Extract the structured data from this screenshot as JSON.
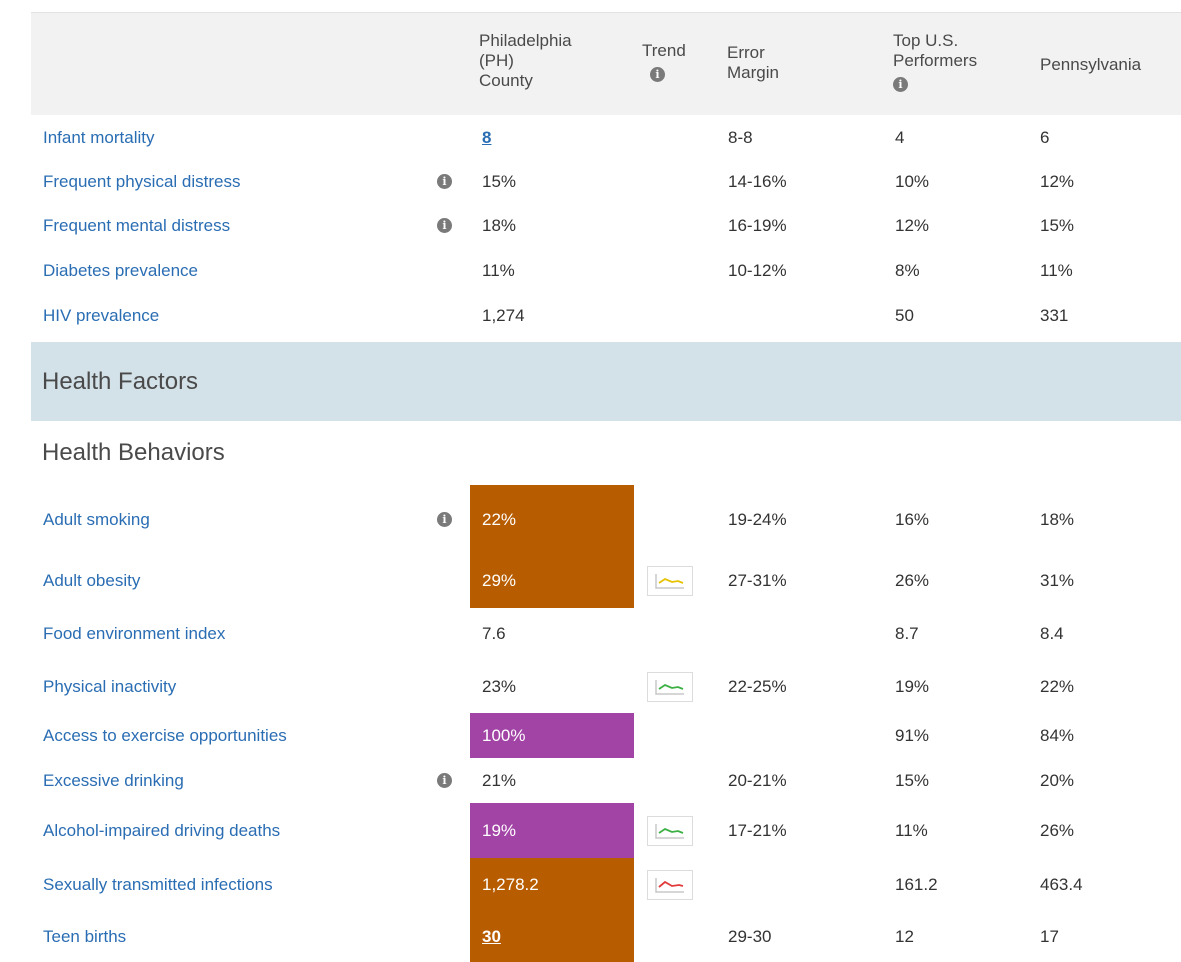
{
  "header": {
    "county": "Philadelphia\n(PH)\nCounty",
    "trend": "Trend",
    "error_margin": "Error\nMargin",
    "top_performers": "Top U.S.\nPerformers",
    "state": "Pennsylvania"
  },
  "section_health_outcomes_rows": [
    {
      "measure": "Infant mortality",
      "info": false,
      "value": "8",
      "value_link": true,
      "trend": null,
      "error": "8-8",
      "top": "4",
      "state": "6"
    },
    {
      "measure": "Frequent physical distress",
      "info": true,
      "value": "15%",
      "trend": null,
      "error": "14-16%",
      "top": "10%",
      "state": "12%"
    },
    {
      "measure": "Frequent mental distress",
      "info": true,
      "value": "18%",
      "trend": null,
      "error": "16-19%",
      "top": "12%",
      "state": "15%"
    },
    {
      "measure": "Diabetes prevalence",
      "info": false,
      "value": "11%",
      "trend": null,
      "error": "10-12%",
      "top": "8%",
      "state": "11%"
    },
    {
      "measure": "HIV prevalence",
      "info": false,
      "value": "1,274",
      "trend": null,
      "error": "",
      "top": "50",
      "state": "331"
    }
  ],
  "bands": {
    "health_factors": "Health Factors",
    "health_behaviors": "Health Behaviors"
  },
  "behavior_rows": [
    {
      "measure": "Adult smoking",
      "info": true,
      "value": "22%",
      "highlight": "orange",
      "trend": null,
      "error": "19-24%",
      "top": "16%",
      "state": "18%"
    },
    {
      "measure": "Adult obesity",
      "info": false,
      "value": "29%",
      "highlight": "orange",
      "trend": "yellow",
      "error": "27-31%",
      "top": "26%",
      "state": "31%"
    },
    {
      "measure": "Food environment index",
      "info": false,
      "value": "7.6",
      "highlight": null,
      "trend": null,
      "error": "",
      "top": "8.7",
      "state": "8.4"
    },
    {
      "measure": "Physical inactivity",
      "info": false,
      "value": "23%",
      "highlight": null,
      "trend": "green",
      "error": "22-25%",
      "top": "19%",
      "state": "22%"
    },
    {
      "measure": "Access to exercise opportunities",
      "info": false,
      "value": "100%",
      "highlight": "purple",
      "trend": null,
      "error": "",
      "top": "91%",
      "state": "84%"
    },
    {
      "measure": "Excessive drinking",
      "info": true,
      "value": "21%",
      "highlight": null,
      "trend": null,
      "error": "20-21%",
      "top": "15%",
      "state": "20%"
    },
    {
      "measure": "Alcohol-impaired driving deaths",
      "info": false,
      "value": "19%",
      "highlight": "purple",
      "trend": "green",
      "error": "17-21%",
      "top": "11%",
      "state": "26%"
    },
    {
      "measure": "Sexually transmitted infections",
      "info": false,
      "value": "1,278.2",
      "highlight": "orange",
      "trend": "red",
      "error": "",
      "top": "161.2",
      "state": "463.4"
    },
    {
      "measure": "Teen births",
      "info": false,
      "value": "30",
      "value_link": true,
      "highlight": "orange",
      "trend": null,
      "error": "29-30",
      "top": "12",
      "state": "17"
    }
  ],
  "colors": {
    "orange": "#b85c00",
    "purple": "#a243a6",
    "link": "#2a6db3",
    "trend_yellow": "#e6c200",
    "trend_green": "#3cb043",
    "trend_red": "#e23b3b"
  },
  "icons": {
    "info": "info-icon",
    "trend": "sparkline-icon"
  }
}
